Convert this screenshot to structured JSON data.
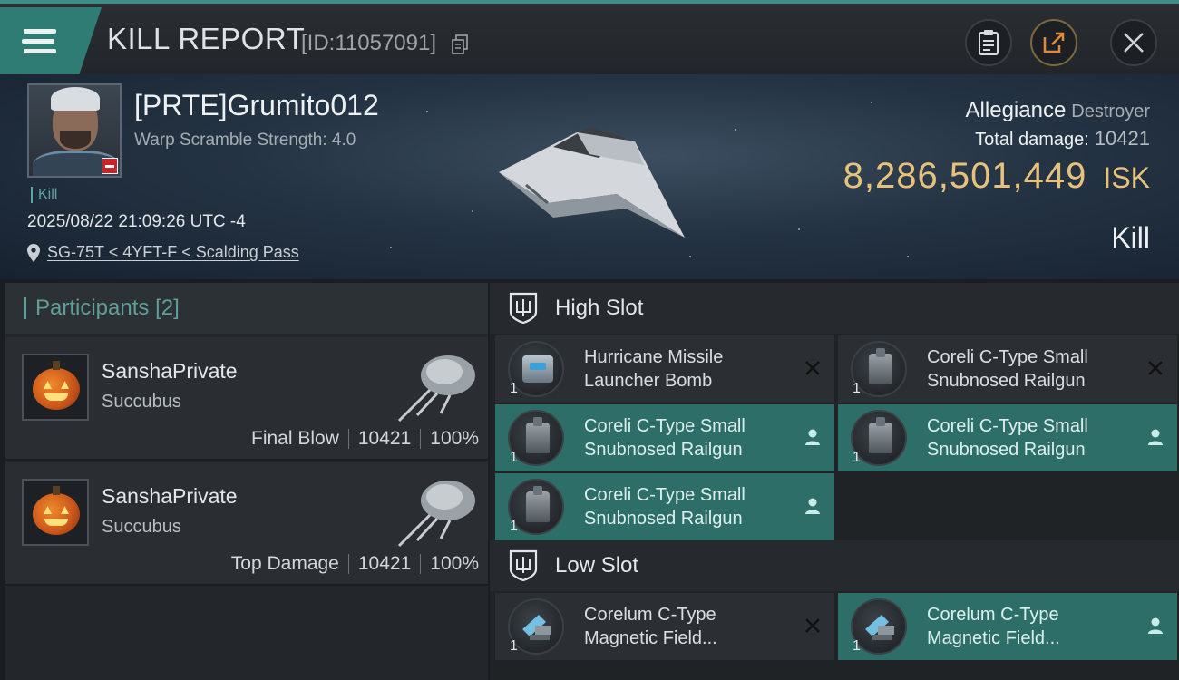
{
  "topbar": {
    "title": "KILL REPORT",
    "report_id": "[ID:11057091]"
  },
  "victim": {
    "name": "[PRTE]Grumito012",
    "warp_scramble": "Warp Scramble Strength: 4.0",
    "kill_tag": "Kill",
    "datetime": "2025/08/22 21:09:26 UTC -4",
    "location": "SG-75T < 4YFT-F < Scalding Pass",
    "allegiance_label": "Allegiance",
    "allegiance_value": "Destroyer",
    "total_damage_label": "Total damage:",
    "total_damage_value": "10421",
    "isk_value": "8,286,501,449",
    "isk_unit": "ISK",
    "result": "Kill"
  },
  "participants": {
    "header": "Participants",
    "count": "[2]",
    "items": [
      {
        "name": "SanshaPrivate",
        "ship": "Succubus",
        "role": "Final Blow",
        "damage": "10421",
        "percent": "100%"
      },
      {
        "name": "SanshaPrivate",
        "ship": "Succubus",
        "role": "Top Damage",
        "damage": "10421",
        "percent": "100%"
      }
    ]
  },
  "slots": {
    "high": {
      "label": "High Slot",
      "modules": [
        {
          "name": "Hurricane Missile Launcher Bomb",
          "qty": "1",
          "state": "destroyed",
          "icon": "missile-launcher-icon"
        },
        {
          "name": "Coreli C-Type Small Snubnosed Railgun",
          "qty": "1",
          "state": "destroyed",
          "icon": "railgun-icon"
        },
        {
          "name": "Coreli C-Type Small Snubnosed Railgun",
          "qty": "1",
          "state": "dropped",
          "icon": "railgun-icon"
        },
        {
          "name": "Coreli C-Type Small Snubnosed Railgun",
          "qty": "1",
          "state": "dropped",
          "icon": "railgun-icon"
        },
        {
          "name": "Coreli C-Type Small Snubnosed Railgun",
          "qty": "1",
          "state": "dropped",
          "icon": "railgun-icon"
        }
      ]
    },
    "low": {
      "label": "Low Slot",
      "modules": [
        {
          "name": "Corelum C-Type Magnetic Field...",
          "qty": "1",
          "state": "destroyed",
          "icon": "magnetic-field-icon"
        },
        {
          "name": "Corelum C-Type Magnetic Field...",
          "qty": "1",
          "state": "dropped",
          "icon": "magnetic-field-icon"
        }
      ]
    }
  },
  "colors": {
    "accent": "#2f7c75",
    "fitted": "#2e6e69",
    "isk": "#e8c27a"
  }
}
